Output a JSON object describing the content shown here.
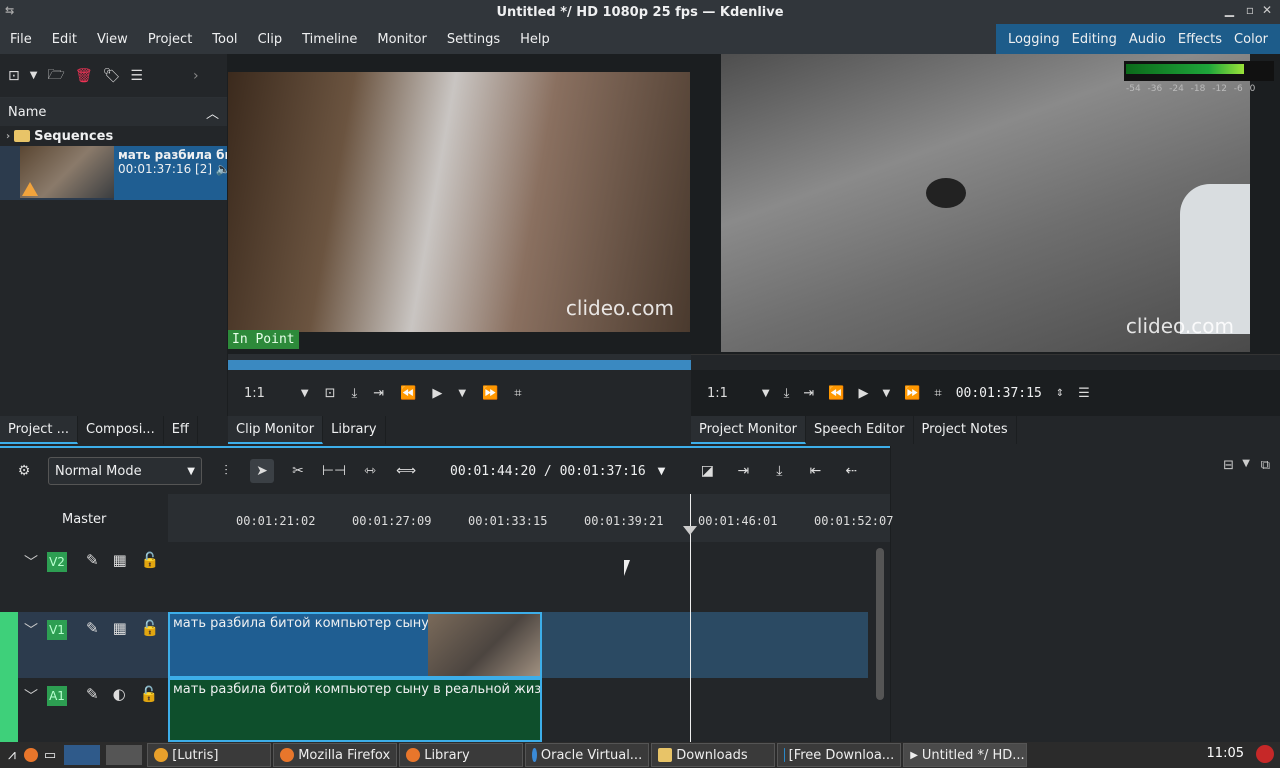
{
  "window": {
    "title": "Untitled */ HD 1080p 25 fps — Kdenlive"
  },
  "menu": [
    "File",
    "Edit",
    "View",
    "Project",
    "Tool",
    "Clip",
    "Timeline",
    "Monitor",
    "Settings",
    "Help"
  ],
  "layouts": [
    "Logging",
    "Editing",
    "Audio",
    "Effects",
    "Color"
  ],
  "bin": {
    "header": "Name",
    "folder": "Sequences",
    "clip": {
      "name": "мать разбила би",
      "duration": "00:01:37:16 [2]"
    }
  },
  "bin_tabs": [
    "Project ...",
    "Composi...",
    "Eff"
  ],
  "clip_monitor": {
    "watermark": "clideo.com",
    "in_point": "In Point",
    "zoom": "1:1"
  },
  "monitor_tabs": [
    "Clip Monitor",
    "Library"
  ],
  "project_monitor": {
    "watermark": "clideo.com",
    "zoom": "1:1",
    "timecode": "00:01:37:15",
    "meter_labels": "-54 -36 -24 -18 -12 -6 0"
  },
  "project_tabs": [
    "Project Monitor",
    "Speech Editor",
    "Project Notes"
  ],
  "timeline": {
    "mode": "Normal Mode",
    "position": "00:01:44:20 / 00:01:37:16",
    "master": "Master",
    "ticks": [
      "00:01:21:02",
      "00:01:27:09",
      "00:01:33:15",
      "00:01:39:21",
      "00:01:46:01",
      "00:01:52:07"
    ],
    "tracks": [
      {
        "name": "V2",
        "kind": "video"
      },
      {
        "name": "V1",
        "kind": "video",
        "clip": "мать разбила битой компьютер сыну в реальной жизни из"
      },
      {
        "name": "A1",
        "kind": "audio",
        "clip": "мать разбила битой компьютер сыну в реальной жизни из"
      }
    ]
  },
  "taskbar": {
    "tasks": [
      "[Lutris]",
      "Mozilla Firefox",
      "Library",
      "Oracle Virtual...",
      "Downloads",
      "[Free Downloa...",
      "Untitled */ HD..."
    ],
    "clock": "11:05"
  },
  "colors": {
    "accent": "#3daee9",
    "track_green": "#3ed07a",
    "clip_video": "#1f5e92",
    "clip_audio": "#0e4f2c"
  }
}
